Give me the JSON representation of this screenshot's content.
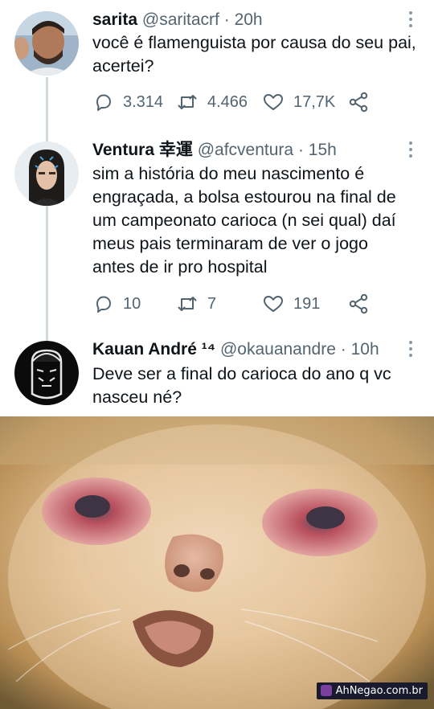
{
  "tweets": [
    {
      "name": "sarita",
      "handle": "@saritacrf",
      "time": "20h",
      "text": "você é flamenguista por causa do seu pai, acertei?",
      "replies": "3.314",
      "retweets": "4.466",
      "likes": "17,7K"
    },
    {
      "name": "Ventura 幸運",
      "handle": "@afcventura",
      "time": "15h",
      "text": "sim a história do meu nascimento é engraçada, a bolsa estourou na final de um campeonato carioca (n sei qual) daí meus pais terminaram de ver o jogo antes de ir pro hospital",
      "replies": "10",
      "retweets": "7",
      "likes": "191"
    },
    {
      "name": "Kauan André ¹⁴",
      "handle": "@okauanandre",
      "time": "10h",
      "text": "Deve ser a final do carioca do ano q vc nasceu né?"
    }
  ],
  "separator": "·",
  "watermark": "AhNegao.com.br",
  "colors": {
    "text": "#0f1419",
    "secondary": "#536471",
    "thread_line": "#cfd9de"
  }
}
